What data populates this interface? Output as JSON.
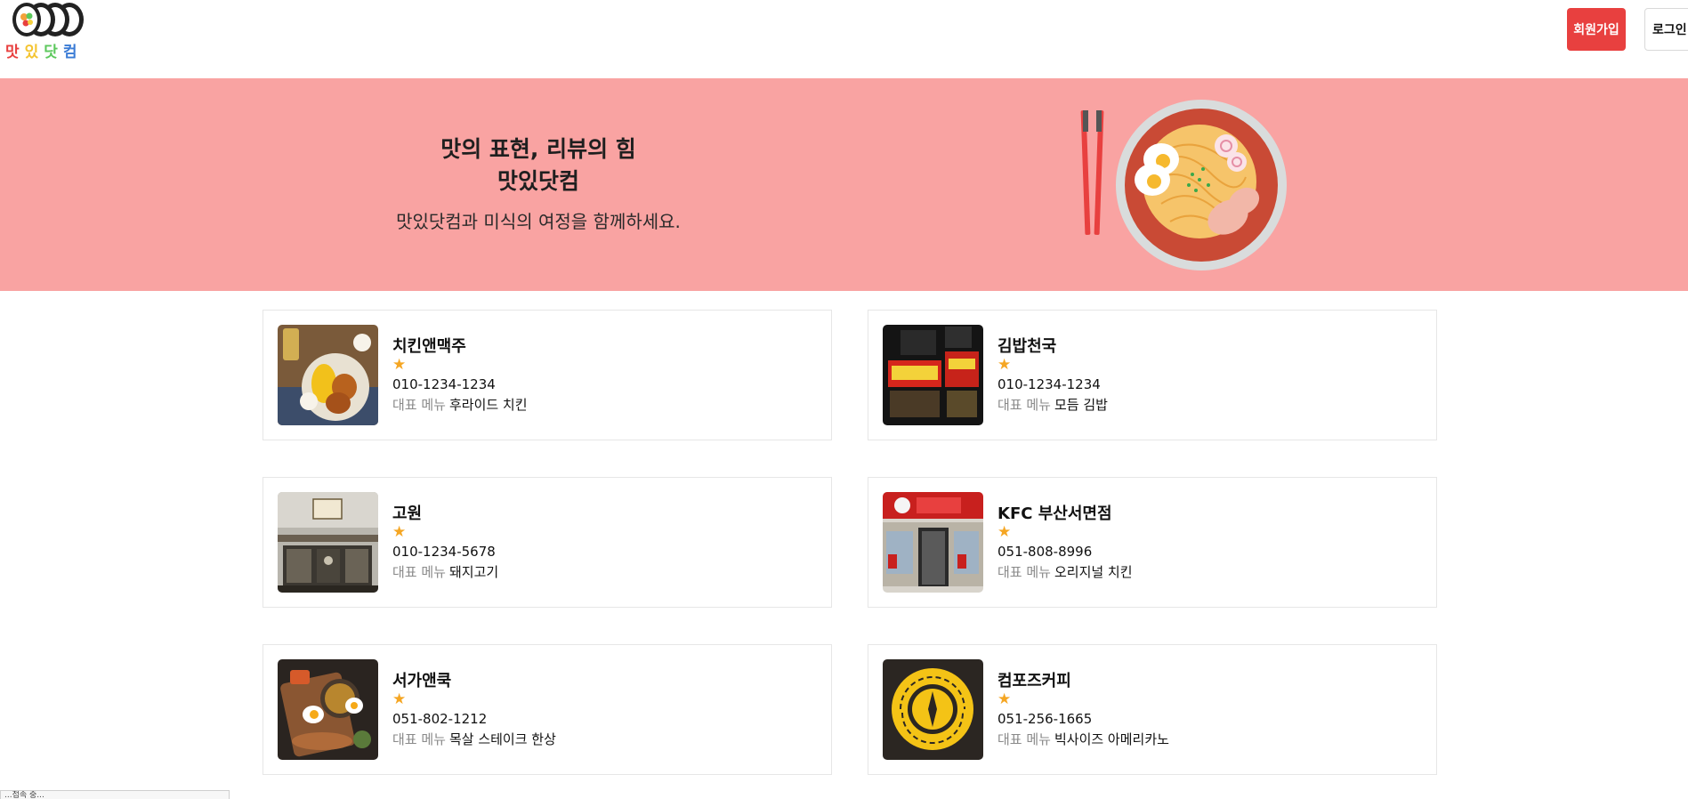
{
  "header": {
    "logo_chars": [
      {
        "char": "맛",
        "color": "#e8403f"
      },
      {
        "char": "있",
        "color": "#f4c430"
      },
      {
        "char": "닷",
        "color": "#5cc85c"
      },
      {
        "char": "컴",
        "color": "#3a7bd5"
      }
    ],
    "signup_label": "회원가입",
    "login_label": "로그인"
  },
  "hero": {
    "title_line1": "맛의 표현, 리뷰의 힘",
    "title_line2": "맛있닷컴",
    "subtitle": "맛있닷컴과 미식의 여정을 함께하세요."
  },
  "restaurants": [
    {
      "name": "치킨앤맥주",
      "rating_icon": "★",
      "phone": "010-1234-1234",
      "menu_label": "대표 메뉴",
      "menu": "후라이드 치킨"
    },
    {
      "name": "김밥천국",
      "rating_icon": "★",
      "phone": "010-1234-1234",
      "menu_label": "대표 메뉴",
      "menu": "모듬 김밥"
    },
    {
      "name": "고원",
      "rating_icon": "★",
      "phone": "010-1234-5678",
      "menu_label": "대표 메뉴",
      "menu": "돼지고기"
    },
    {
      "name": "KFC 부산서면점",
      "rating_icon": "★",
      "phone": "051-808-8996",
      "menu_label": "대표 메뉴",
      "menu": "오리지널 치킨"
    },
    {
      "name": "서가앤쿡",
      "rating_icon": "★",
      "phone": "051-802-1212",
      "menu_label": "대표 메뉴",
      "menu": "목살 스테이크 한상"
    },
    {
      "name": "컴포즈커피",
      "rating_icon": "★",
      "phone": "051-256-1665",
      "menu_label": "대표 메뉴",
      "menu": "빅사이즈 아메리카노"
    }
  ],
  "status_bar": {
    "text": "...접속 중..."
  }
}
